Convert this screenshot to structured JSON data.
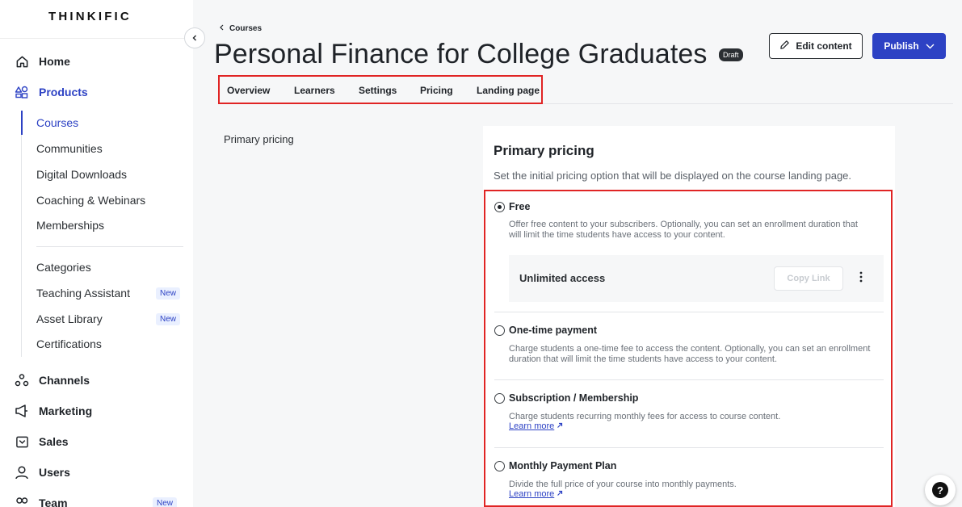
{
  "app": {
    "logo": "THINKIFIC"
  },
  "sidebar": {
    "nav": [
      {
        "label": "Home",
        "icon": "home-icon"
      },
      {
        "label": "Products",
        "icon": "products-icon",
        "active": true
      },
      {
        "label": "Channels",
        "icon": "channels-icon"
      },
      {
        "label": "Marketing",
        "icon": "megaphone-icon"
      },
      {
        "label": "Sales",
        "icon": "sales-icon"
      },
      {
        "label": "Users",
        "icon": "user-icon"
      },
      {
        "label": "Team",
        "icon": "team-icon",
        "badge": "New"
      }
    ],
    "products_sub": [
      {
        "label": "Courses",
        "active": true
      },
      {
        "label": "Communities"
      },
      {
        "label": "Digital Downloads"
      },
      {
        "label": "Coaching & Webinars"
      },
      {
        "label": "Memberships"
      },
      {
        "label": "Categories"
      },
      {
        "label": "Teaching Assistant",
        "badge": "New"
      },
      {
        "label": "Asset Library",
        "badge": "New"
      },
      {
        "label": "Certifications"
      }
    ]
  },
  "header": {
    "breadcrumb": "Courses",
    "title": "Personal Finance for College Graduates",
    "status_badge": "Draft",
    "edit_button": "Edit content",
    "publish_button": "Publish"
  },
  "tabs": [
    "Overview",
    "Learners",
    "Settings",
    "Pricing",
    "Landing page"
  ],
  "pricing": {
    "section_label": "Primary pricing",
    "card_title": "Primary pricing",
    "card_description": "Set the initial pricing option that will be displayed on the course landing page.",
    "options": [
      {
        "title": "Free",
        "checked": true,
        "description": "Offer free content to your subscribers. Optionally, you can set an enrollment duration that will limit the time students have access to your content."
      },
      {
        "title": "One-time payment",
        "checked": false,
        "description": "Charge students a one-time fee to access the content. Optionally, you can set an enrollment duration that will limit the time students have access to your content."
      },
      {
        "title": "Subscription / Membership",
        "checked": false,
        "description": "Charge students recurring monthly fees for access to course content.",
        "link": "Learn more"
      },
      {
        "title": "Monthly Payment Plan",
        "checked": false,
        "description": "Divide the full price of your course into monthly payments.",
        "link": "Learn more"
      }
    ],
    "free_access": {
      "label": "Unlimited access",
      "copy_link": "Copy Link"
    }
  },
  "help": {
    "label": "?"
  },
  "colors": {
    "accent": "#2d42c4",
    "highlight": "#e02424"
  }
}
